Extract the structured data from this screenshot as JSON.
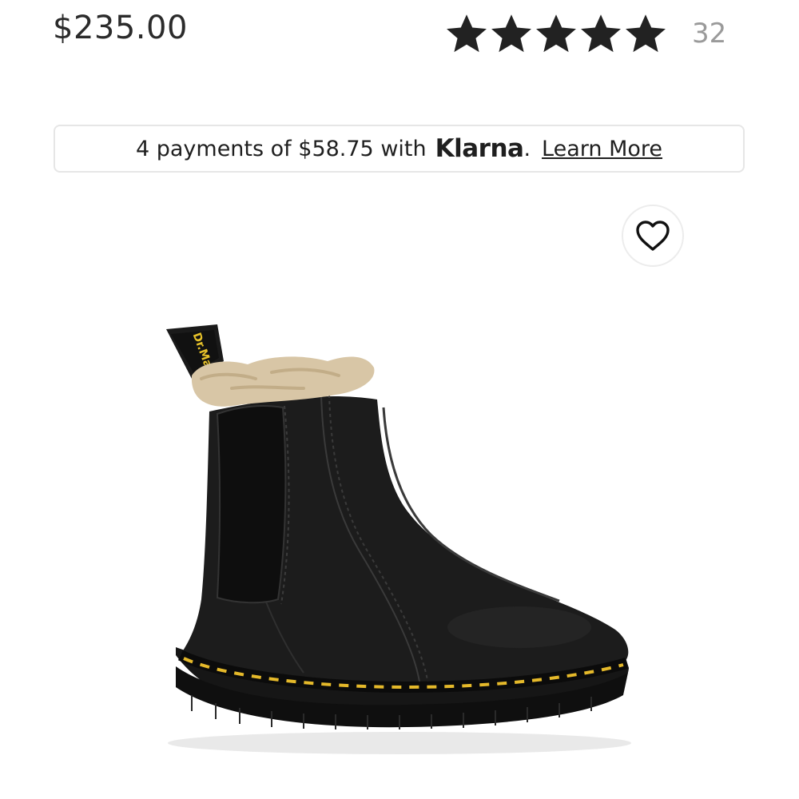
{
  "product": {
    "price": "$235.00",
    "rating_value": 5,
    "rating_max": 5,
    "review_count": "32",
    "star_color": "#222222",
    "image_icon": "chelsea-boot-image"
  },
  "klarna": {
    "text": "4 payments of $58.75 with",
    "brand": "Klarna",
    "period": ".",
    "learn_more": "Learn More"
  },
  "wishlist": {
    "icon": "heart-outline-icon"
  },
  "boot_label": {
    "pull_tab_text": "Dr.Martens"
  }
}
